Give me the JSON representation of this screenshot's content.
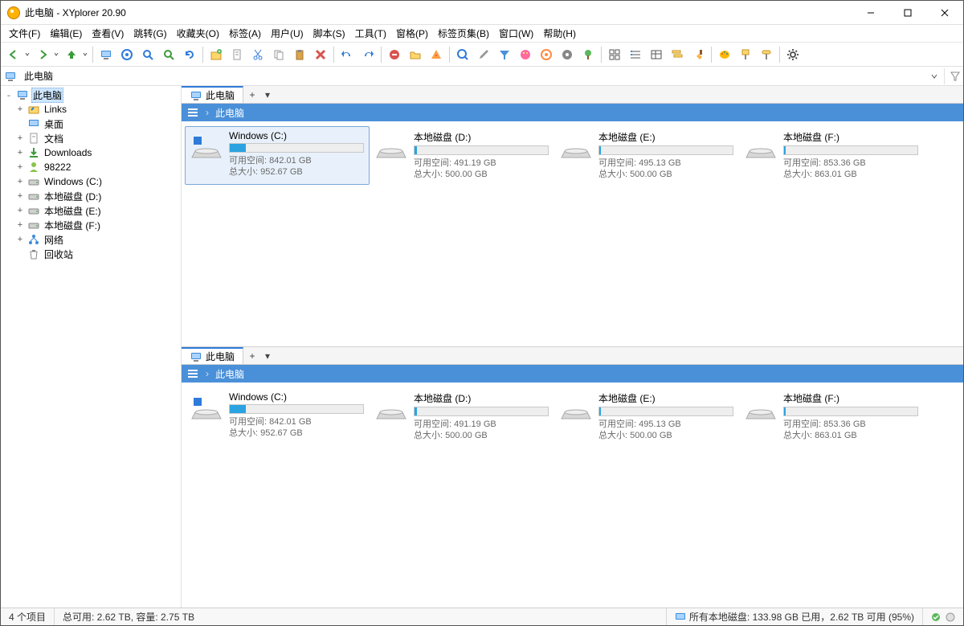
{
  "title": "此电脑 - XYplorer 20.90",
  "menu": [
    "文件(F)",
    "编辑(E)",
    "查看(V)",
    "跳转(G)",
    "收藏夹(O)",
    "标签(A)",
    "用户(U)",
    "脚本(S)",
    "工具(T)",
    "窗格(P)",
    "标签页集(B)",
    "窗口(W)",
    "帮助(H)"
  ],
  "toolbar_icons": [
    "back-icon",
    "forward-icon",
    "up-icon",
    "sep",
    "monitor-icon",
    "target-icon",
    "search-blue-icon",
    "search-green-icon",
    "refresh-icon",
    "sep",
    "openwith-icon",
    "doc-icon",
    "cut-icon",
    "copy-icon",
    "paste-icon",
    "delete-icon",
    "sep",
    "undo-icon",
    "redo-icon",
    "sep",
    "stop-red-icon",
    "folder-yellow-icon",
    "pizza-icon",
    "sep",
    "zoom-blue-icon",
    "dropper-icon",
    "funnel-icon",
    "palette-icon",
    "target-orange-icon",
    "disc-grey-icon",
    "tree-green-icon",
    "sep",
    "grid-icon",
    "details-icon",
    "list-icon",
    "queue-icon",
    "brush-icon",
    "sep",
    "palette2-icon",
    "paint-icon",
    "roller-icon",
    "sep",
    "gear-icon"
  ],
  "address": {
    "label": "此电脑"
  },
  "tree": {
    "root": {
      "label": "此电脑",
      "expander": "˗"
    },
    "children": [
      {
        "icon": "link",
        "label": "Links",
        "expander": "+"
      },
      {
        "icon": "desktop",
        "label": "桌面",
        "expander": ""
      },
      {
        "icon": "docs",
        "label": "文档",
        "expander": "+"
      },
      {
        "icon": "downloads",
        "label": "Downloads",
        "expander": "+"
      },
      {
        "icon": "user",
        "label": "98222",
        "expander": "+"
      },
      {
        "icon": "drive",
        "label": "Windows (C:)",
        "expander": "+"
      },
      {
        "icon": "drive",
        "label": "本地磁盘 (D:)",
        "expander": "+"
      },
      {
        "icon": "drive",
        "label": "本地磁盘 (E:)",
        "expander": "+"
      },
      {
        "icon": "drive",
        "label": "本地磁盘 (F:)",
        "expander": "+"
      },
      {
        "icon": "network",
        "label": "网络",
        "expander": "+"
      },
      {
        "icon": "recycle",
        "label": "回收站",
        "expander": ""
      }
    ]
  },
  "pane": {
    "tab_label": "此电脑",
    "breadcrumb": "此电脑",
    "drives": [
      {
        "name": "Windows (C:)",
        "free_label": "可用空间: 842.01 GB",
        "total_label": "总大小: 952.67 GB",
        "fill_pct": 12
      },
      {
        "name": "本地磁盘 (D:)",
        "free_label": "可用空间: 491.19 GB",
        "total_label": "总大小: 500.00 GB",
        "fill_pct": 2
      },
      {
        "name": "本地磁盘 (E:)",
        "free_label": "可用空间: 495.13 GB",
        "total_label": "总大小: 500.00 GB",
        "fill_pct": 1
      },
      {
        "name": "本地磁盘 (F:)",
        "free_label": "可用空间: 853.36 GB",
        "total_label": "总大小: 863.01 GB",
        "fill_pct": 1
      }
    ]
  },
  "status": {
    "items": "4 个项目",
    "totals": "总可用: 2.62 TB, 容量: 2.75 TB",
    "right": "所有本地磁盘: 133.98 GB 已用，2.62 TB 可用 (95%)"
  }
}
